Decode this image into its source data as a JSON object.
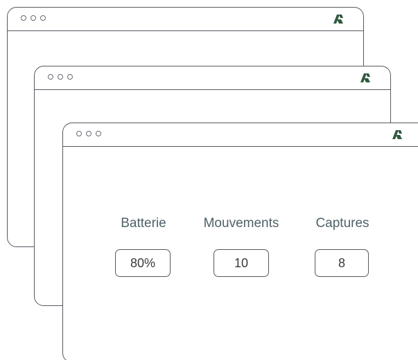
{
  "windows": [
    {
      "name": "back-window"
    },
    {
      "name": "middle-window"
    },
    {
      "name": "front-window"
    }
  ],
  "colors": {
    "outline": "#5a5660",
    "logo": "#2f5a3e",
    "label_text": "#4f6168"
  },
  "icons": {
    "logo": "brand-logo-icon"
  },
  "stats": [
    {
      "label": "Batterie",
      "value": "80%"
    },
    {
      "label": "Mouvements",
      "value": "10"
    },
    {
      "label": "Captures",
      "value": "8"
    }
  ]
}
